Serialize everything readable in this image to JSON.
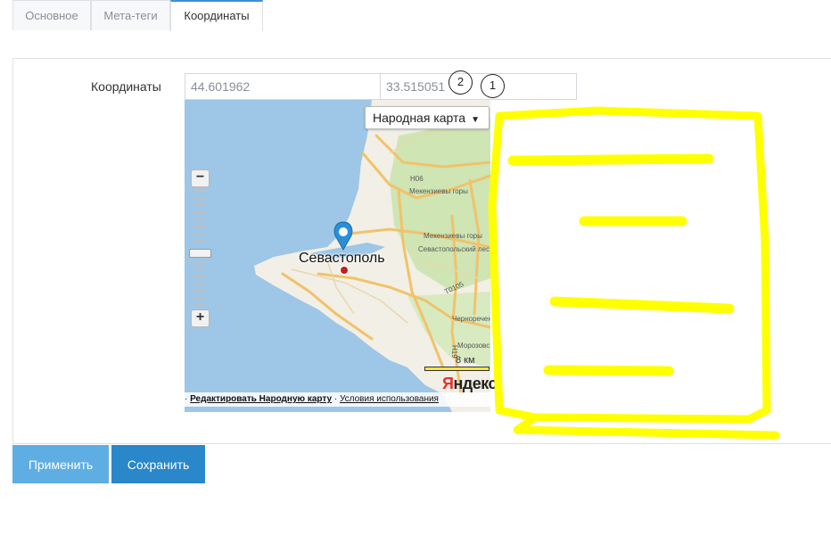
{
  "tabs": [
    {
      "label": "Основное",
      "active": false
    },
    {
      "label": "Мета-теги",
      "active": false
    },
    {
      "label": "Координаты",
      "active": true
    }
  ],
  "coordinates": {
    "label": "Координаты",
    "latitude": "44.601962",
    "longitude": "33.515051"
  },
  "annotations": {
    "circle_1": "1",
    "circle_2": "2"
  },
  "map": {
    "type_selector": "Народная карта",
    "type_arrow": "▼",
    "zoom_out": "−",
    "zoom_in": "+",
    "city": "Севастополь",
    "place_labels": [
      "Н06",
      "Мекензиевы горы",
      "Мекензиевы горы",
      "Севастопольский лес",
      "Т0105",
      "Черноречен-ский каньон",
      "Морозовс",
      "Н19"
    ],
    "scale": "8 км",
    "logo_first": "Я",
    "logo_rest": "ндекс",
    "edit_link": "Редактировать Народную карту",
    "terms_link": "Условия использования",
    "separator": "·",
    "colors": {
      "water": "#9ec6e6",
      "land": "#f2efe6",
      "road": "#f0c36a",
      "green": "#cfe5b4"
    }
  },
  "buttons": {
    "apply": "Применить",
    "save": "Сохранить"
  },
  "highlight_color": "#ffff00"
}
